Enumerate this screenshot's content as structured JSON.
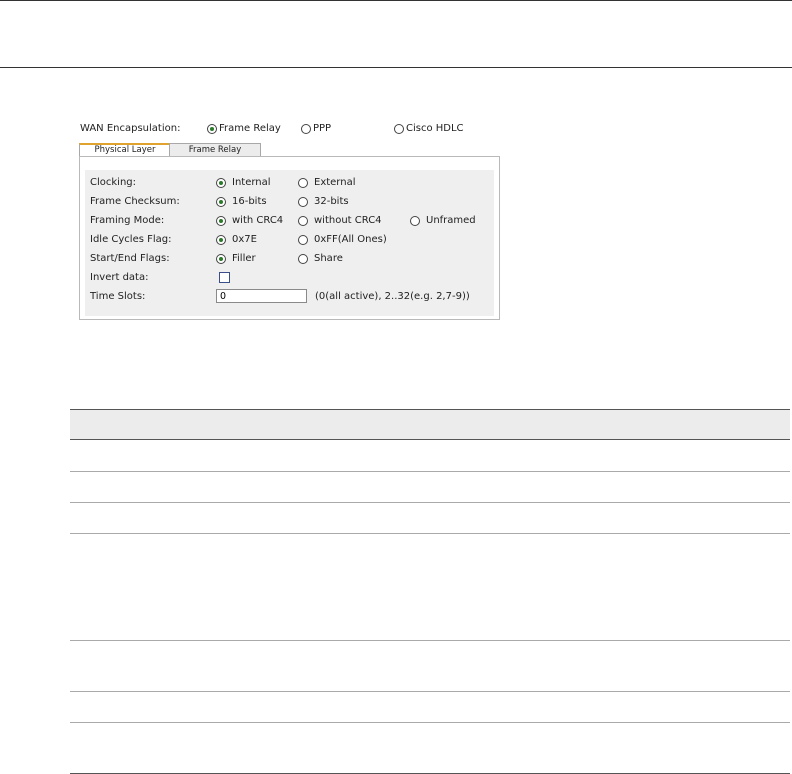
{
  "wan": {
    "label": "WAN Encapsulation:",
    "options": [
      {
        "label": "Frame Relay",
        "selected": true
      },
      {
        "label": "PPP",
        "selected": false
      },
      {
        "label": "Cisco HDLC",
        "selected": false
      }
    ]
  },
  "tabs": [
    {
      "label": "Physical Layer",
      "active": true
    },
    {
      "label": "Frame Relay",
      "active": false
    }
  ],
  "settings": {
    "clocking": {
      "label": "Clocking:",
      "options": [
        "Internal",
        "External"
      ],
      "selected": 0
    },
    "checksum": {
      "label": "Frame Checksum:",
      "options": [
        "16-bits",
        "32-bits"
      ],
      "selected": 0
    },
    "framing": {
      "label": "Framing Mode:",
      "options": [
        "with CRC4",
        "without CRC4",
        "Unframed"
      ],
      "selected": 0
    },
    "idle": {
      "label": "Idle Cycles Flag:",
      "options": [
        "0x7E",
        "0xFF(All Ones)"
      ],
      "selected": 0
    },
    "startend": {
      "label": "Start/End Flags:",
      "options": [
        "Filler",
        "Share"
      ],
      "selected": 0
    },
    "invert": {
      "label": "Invert data:",
      "checked": false
    },
    "timeslots": {
      "label": "Time Slots:",
      "value": "0",
      "hint": "(0(all active), 2..32(e.g. 2,7-9))"
    }
  },
  "colors": {
    "tab_accent": "#e0a330",
    "radio_dot": "#2a7a2a",
    "panel_bg": "#efefef"
  }
}
